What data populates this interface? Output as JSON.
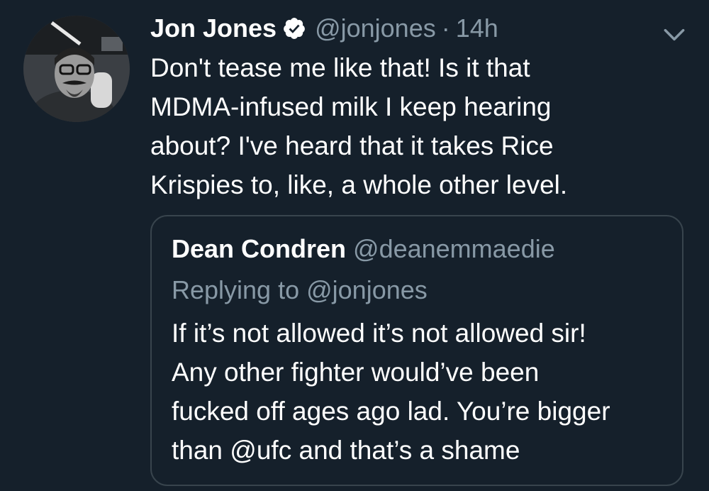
{
  "tweet": {
    "author_name": "Jon Jones",
    "author_handle": "@jonjones",
    "separator": "·",
    "time": "14h",
    "text_lines": [
      "Don't tease me like that! Is it that",
      "MDMA-infused milk I keep hearing",
      "about? I've heard that it takes Rice",
      "Krispies to, like, a whole other level."
    ],
    "avatar_icon": "profile-photo",
    "verified_icon": "verified-badge-icon",
    "menu_icon": "chevron-down-icon"
  },
  "quoted_tweet": {
    "author_name": "Dean Condren",
    "author_handle": "@deanemmaedie",
    "replying_to": "Replying to @jonjones",
    "text_lines": [
      "If it’s not allowed it’s not allowed sir!",
      "Any other fighter would’ve been",
      "fucked off ages ago lad. You’re bigger",
      "than @ufc and that’s a shame"
    ]
  },
  "colors": {
    "background": "#15202b",
    "primary_text": "#ffffff",
    "secondary_text": "#8899a6",
    "border": "#38444d"
  }
}
